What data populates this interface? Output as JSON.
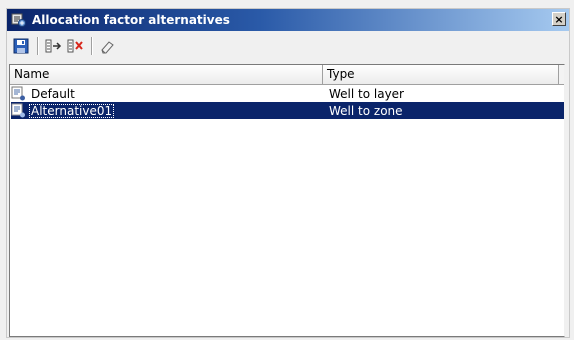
{
  "window": {
    "title": "Allocation factor alternatives",
    "close_label": "×"
  },
  "toolbar": {
    "buttons": [
      {
        "icon": "save-icon"
      },
      {
        "icon": "add-alternative-icon"
      },
      {
        "icon": "delete-alternative-icon"
      },
      {
        "icon": "eraser-icon"
      }
    ]
  },
  "table": {
    "columns": [
      "Name",
      "Type"
    ],
    "rows": [
      {
        "name": "Default",
        "type": "Well to layer",
        "selected": false
      },
      {
        "name": "Alternative01",
        "type": "Well to zone",
        "selected": true
      }
    ]
  },
  "colors": {
    "title_bar": "#0a246a",
    "selection": "#0a246a"
  }
}
